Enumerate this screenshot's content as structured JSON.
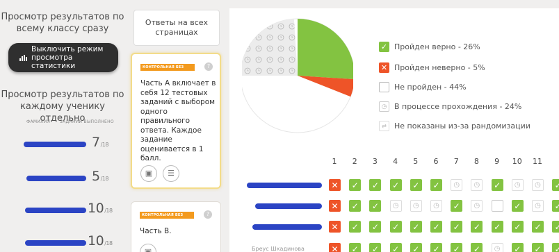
{
  "left_panel": {
    "class_view_title": "Просмотр результатов по всему классу сразу",
    "toggle_button_label": "Выключить режим просмотра статистики",
    "student_view_title": "Просмотр результатов по каждому ученику отдельно",
    "col_surname": "ФАМИЛИЯ",
    "col_done": "ЗАДАНИЙ ВЫПОЛНЕНО",
    "students": [
      {
        "score": "7",
        "of": "/18"
      },
      {
        "score": "5",
        "of": "/18"
      },
      {
        "score": "10",
        "of": "/18"
      },
      {
        "score": "10",
        "of": "/18"
      }
    ]
  },
  "middle_panel": {
    "answers_button_label": "Ответы на всех страницах",
    "cards": [
      {
        "tag": "КОНТРОЛЬНАЯ БЕЗ",
        "text": "Часть А включает в себя 12 тестовых заданий с выбором одного правильного ответа. Каждое задание оценивается в 1 балл."
      },
      {
        "tag": "КОНТРОЛЬНАЯ БЕЗ",
        "text": "Часть В."
      }
    ]
  },
  "right_panel": {
    "chart_data": {
      "type": "pie",
      "slices": [
        {
          "label": "Пройден верно - 26%",
          "value": 26,
          "color": "#83c341"
        },
        {
          "label": "Пройден неверно - 5%",
          "value": 5,
          "color": "#ee5428"
        },
        {
          "label": "Не пройден - 44%",
          "value": 44,
          "color": "#ffffff"
        },
        {
          "label": "В процессе прохождения - 24%",
          "value": 24,
          "color": "#e9e9e9"
        },
        {
          "label": "Не показаны из-за рандомизации",
          "value": null,
          "color": "#ffffff"
        }
      ]
    },
    "columns": [
      "1",
      "2",
      "3",
      "4",
      "5",
      "6",
      "7",
      "8",
      "9",
      "10",
      "11"
    ],
    "rows": [
      {
        "name": "",
        "cells": [
          "bad",
          "ok",
          "ok",
          "ok",
          "ok",
          "ok",
          "prog",
          "prog",
          "ok",
          "prog",
          "prog",
          "ok"
        ]
      },
      {
        "name": "",
        "cells": [
          "bad",
          "ok",
          "ok",
          "prog",
          "prog",
          "prog",
          "ok",
          "prog",
          "empty",
          "ok",
          "prog",
          "ok"
        ]
      },
      {
        "name": "",
        "cells": [
          "bad",
          "ok",
          "ok",
          "ok",
          "ok",
          "ok",
          "ok",
          "ok",
          "ok",
          "ok",
          "ok",
          "ok"
        ]
      },
      {
        "name": "Бреус Шкадинова",
        "cells": [
          "bad",
          "ok",
          "ok",
          "ok",
          "ok",
          "ok",
          "ok",
          "ok",
          "prog",
          "ok",
          "ok",
          "ok"
        ]
      }
    ]
  }
}
